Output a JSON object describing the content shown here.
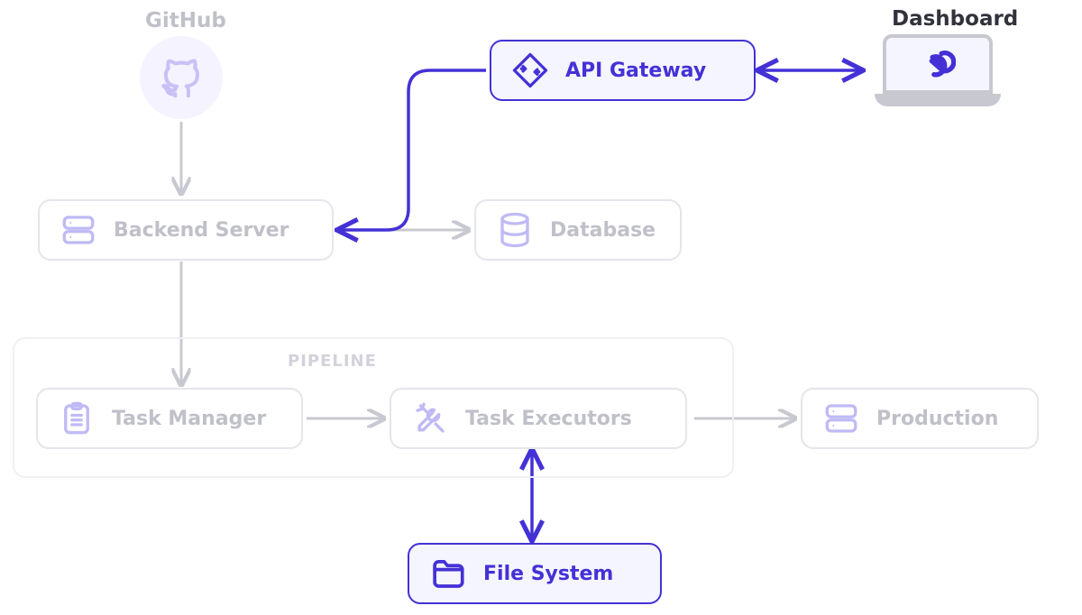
{
  "headings": {
    "github": "GitHub",
    "dashboard": "Dashboard"
  },
  "pipeline": {
    "title": "PIPELINE"
  },
  "nodes": {
    "backend": "Backend Server",
    "database": "Database",
    "task_manager": "Task Manager",
    "task_executors": "Task Executors",
    "production": "Production",
    "api_gateway": "API Gateway",
    "file_system": "File System"
  },
  "colors": {
    "accent": "#4431d6",
    "accent_light": "#f5f5ff",
    "mute_border": "#e5e5eb",
    "mute_text": "#c0c0c9",
    "mute_icon": "#bfbaf5"
  },
  "node_states": {
    "github": "muted",
    "backend": "muted",
    "database": "muted",
    "task_manager": "muted",
    "task_executors": "muted",
    "production": "muted",
    "api_gateway": "highlighted",
    "file_system": "highlighted",
    "dashboard": "highlighted"
  },
  "connections": [
    {
      "from": "github",
      "to": "backend",
      "style": "mute",
      "dir": "uni"
    },
    {
      "from": "backend",
      "to": "task_manager",
      "style": "mute",
      "dir": "uni"
    },
    {
      "from": "backend",
      "to": "database",
      "style": "mute",
      "dir": "uni"
    },
    {
      "from": "task_manager",
      "to": "task_executors",
      "style": "mute",
      "dir": "uni"
    },
    {
      "from": "task_executors",
      "to": "production",
      "style": "mute",
      "dir": "uni"
    },
    {
      "from": "api_gateway",
      "to": "backend",
      "style": "accent",
      "dir": "uni"
    },
    {
      "from": "api_gateway",
      "to": "dashboard",
      "style": "accent",
      "dir": "bi"
    },
    {
      "from": "task_executors",
      "to": "file_system",
      "style": "accent",
      "dir": "bi"
    }
  ]
}
